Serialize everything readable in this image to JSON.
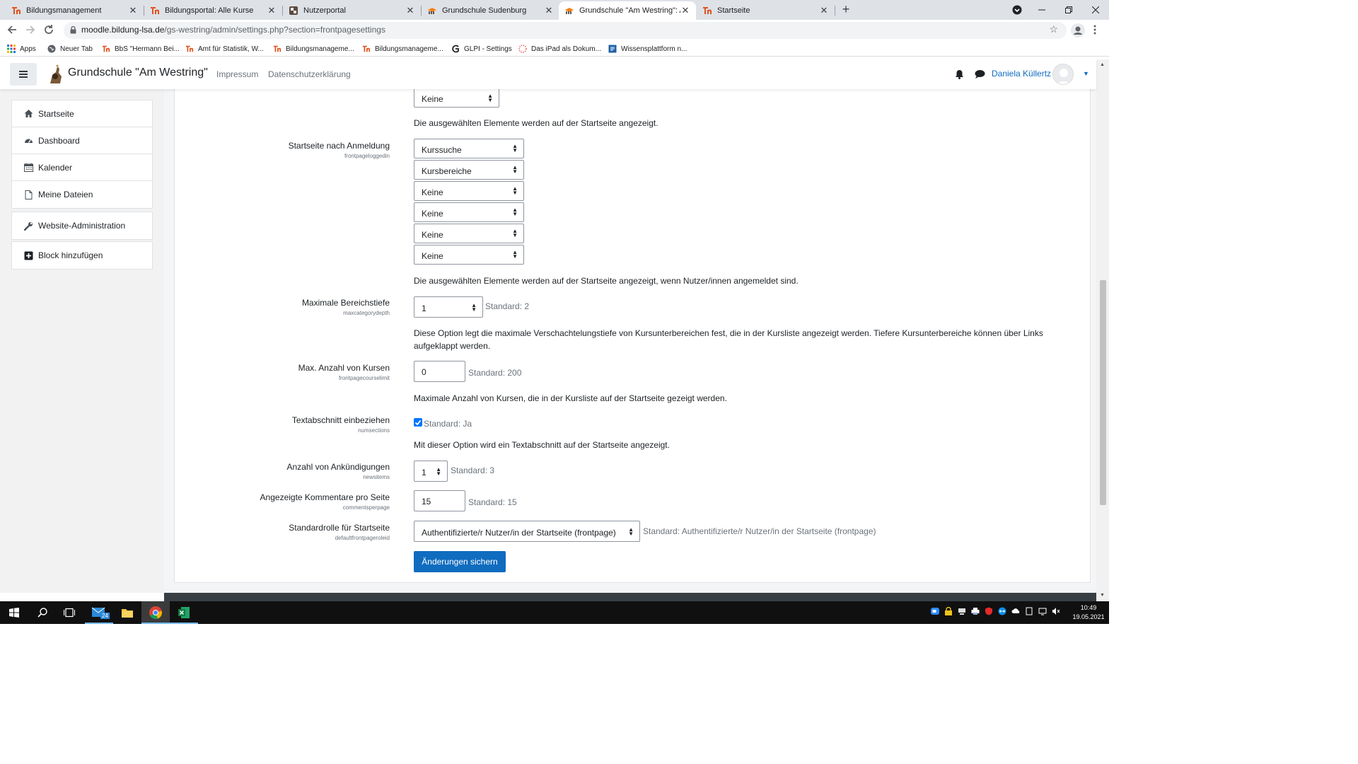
{
  "browser": {
    "tabs": [
      {
        "title": "Bildungsmanagement",
        "icon": "moodle-th-icon"
      },
      {
        "title": "Bildungsportal: Alle Kurse",
        "icon": "moodle-th-icon"
      },
      {
        "title": "Nutzerportal",
        "icon": "portal-icon"
      },
      {
        "title": "Grundschule Sudenburg",
        "icon": "moodle-hat-icon"
      },
      {
        "title": "Grundschule \"Am Westring\": Adr",
        "icon": "moodle-hat-icon"
      },
      {
        "title": "Startseite",
        "icon": "moodle-th-icon"
      }
    ],
    "close_glyph": "✕",
    "new_tab_glyph": "+",
    "url_host": "moodle.bildung-lsa.de",
    "url_path": "/gs-westring/admin/settings.php?section=frontpagesettings",
    "bookmarks": [
      {
        "label": "Apps",
        "icon": "apps-grid-icon"
      },
      {
        "label": "Neuer Tab",
        "icon": "globe-icon"
      },
      {
        "label": "BbS \"Hermann Bei...",
        "icon": "moodle-th-icon"
      },
      {
        "label": "Amt für Statistik, W...",
        "icon": "moodle-th-icon"
      },
      {
        "label": "Bildungsmanageme...",
        "icon": "moodle-th-icon"
      },
      {
        "label": "Bildungsmanageme...",
        "icon": "moodle-th-icon"
      },
      {
        "label": "GLPI - Settings",
        "icon": "glpi-icon"
      },
      {
        "label": "Das iPad als Dokum...",
        "icon": "dotted-circle-icon"
      },
      {
        "label": "Wissensplattform n...",
        "icon": "square-logo-icon"
      }
    ]
  },
  "moodle": {
    "site_name": "Grundschule \"Am Westring\"",
    "nav_links": [
      "Impressum",
      "Datenschutzerklärung"
    ],
    "user_name": "Daniela Küllertz",
    "accent": "#0f6cbf"
  },
  "sidebar": {
    "group1": [
      {
        "label": "Startseite",
        "icon": "home-icon"
      },
      {
        "label": "Dashboard",
        "icon": "dashboard-icon"
      },
      {
        "label": "Kalender",
        "icon": "calendar-icon"
      },
      {
        "label": "Meine Dateien",
        "icon": "file-icon"
      }
    ],
    "group2": [
      {
        "label": "Website-Administration",
        "icon": "wrench-icon"
      }
    ],
    "group3": [
      {
        "label": "Block hinzufügen",
        "icon": "plus-square-icon"
      }
    ]
  },
  "settings": {
    "top_select": "Keine",
    "top_desc": "Die ausgewählten Elemente werden auf der Startseite angezeigt.",
    "loggedin": {
      "label": "Startseite nach Anmeldung",
      "key": "frontpageloggedin",
      "values": [
        "Kurssuche",
        "Kursbereiche",
        "Keine",
        "Keine",
        "Keine",
        "Keine"
      ],
      "desc": "Die ausgewählten Elemente werden auf der Startseite angezeigt, wenn Nutzer/innen angemeldet sind."
    },
    "maxcategorydepth": {
      "label": "Maximale Bereichstiefe",
      "key": "maxcategorydepth",
      "value": "1",
      "default": "Standard: 2",
      "desc": "Diese Option legt die maximale Verschachtelungstiefe von Kursunterbereichen fest, die in der Kursliste angezeigt werden. Tiefere Kursunterbereiche können über Links aufgeklappt werden."
    },
    "courselimit": {
      "label": "Max. Anzahl von Kursen",
      "key": "frontpagecourselimit",
      "value": "0",
      "default": "Standard: 200",
      "desc": "Maximale Anzahl von Kursen, die in der Kursliste auf der Startseite gezeigt werden."
    },
    "numsections": {
      "label": "Textabschnitt einbeziehen",
      "key": "numsections",
      "checked": true,
      "default": "Standard: Ja",
      "desc": "Mit dieser Option wird ein Textabschnitt auf der Startseite angezeigt."
    },
    "newsitems": {
      "label": "Anzahl von Ankündigungen",
      "key": "newsitems",
      "value": "1",
      "default": "Standard: 3"
    },
    "commentsperpage": {
      "label": "Angezeigte Kommentare pro Seite",
      "key": "commentsperpage",
      "value": "15",
      "default": "Standard: 15"
    },
    "defaultrole": {
      "label": "Standardrolle für Startseite",
      "key": "defaultfrontpageroleid",
      "value": "Authentifizierte/r Nutzer/in der Startseite (frontpage)",
      "default": "Standard: Authentifizierte/r Nutzer/in der Startseite (frontpage)"
    },
    "save": "Änderungen sichern"
  },
  "taskbar": {
    "apps": [
      "windows-start-icon",
      "search-icon",
      "task-view-icon",
      "mail-icon",
      "file-explorer-icon",
      "chrome-icon",
      "excel-icon"
    ],
    "mail_badge": "24",
    "time": "10:49",
    "date": "19.05.2021"
  }
}
